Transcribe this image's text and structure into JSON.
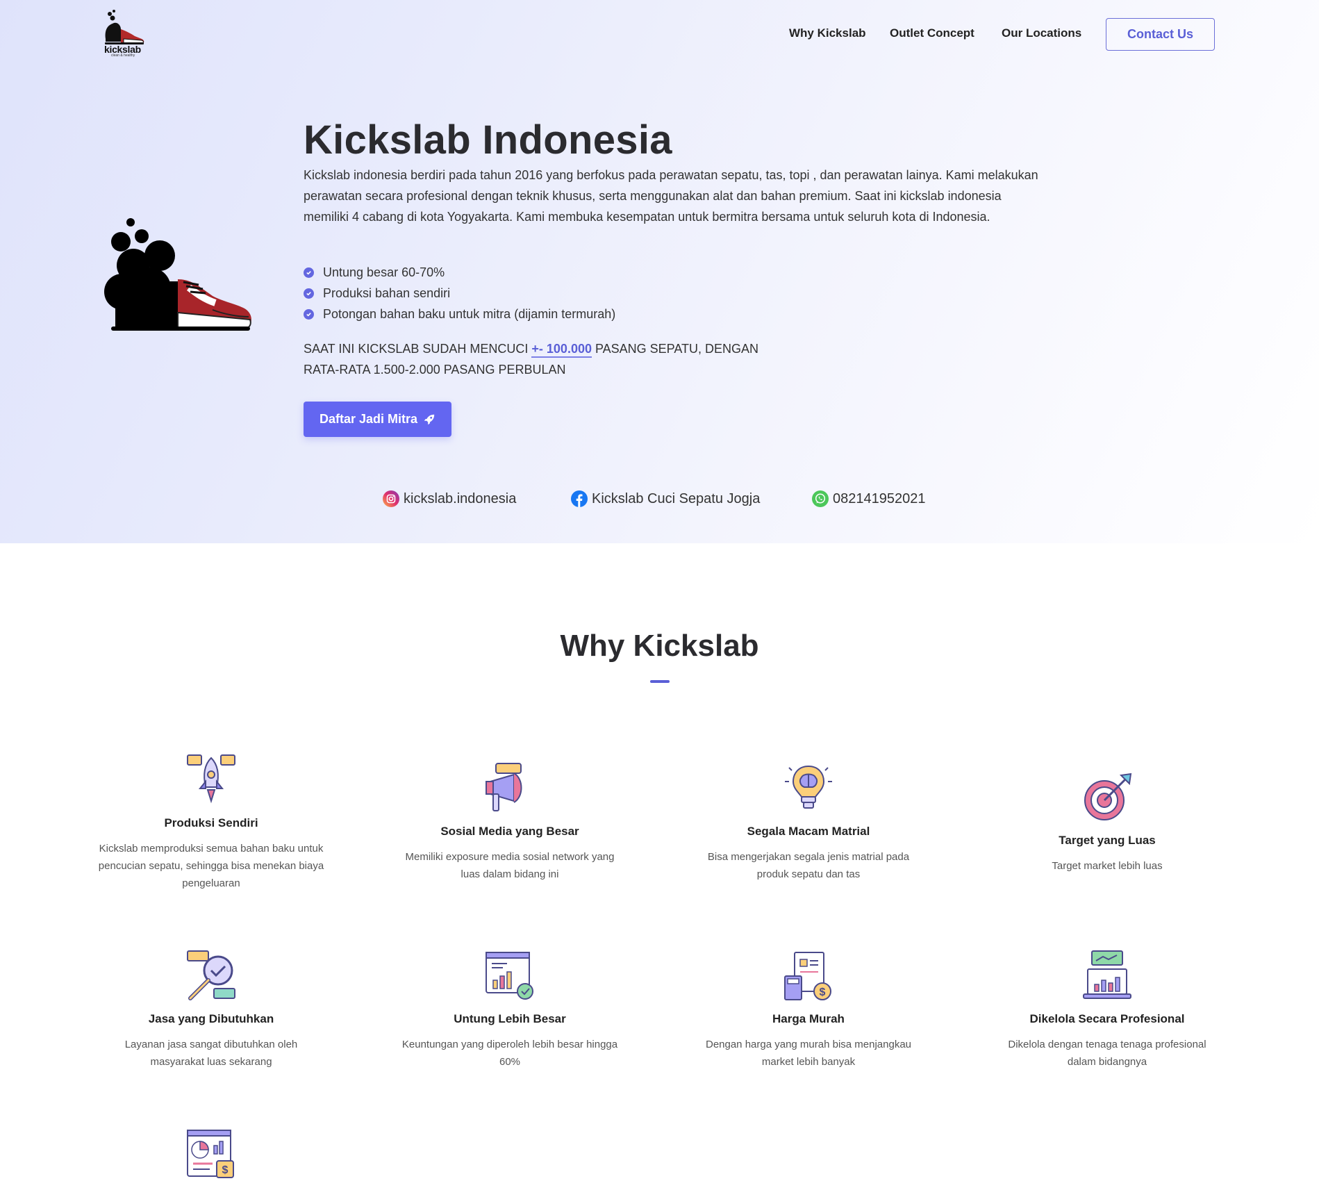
{
  "nav": {
    "logo_text": "kickslab",
    "logo_tagline": "clean & healthy",
    "links": [
      "Why Kickslab",
      "Outlet Concept",
      "Our Locations"
    ],
    "contact_label": "Contact Us"
  },
  "hero": {
    "title": "Kickslab Indonesia",
    "description": "Kickslab indonesia berdiri pada tahun 2016 yang berfokus pada perawatan sepatu, tas, topi , dan perawatan lainya. Kami melakukan perawatan secara profesional dengan teknik khusus, serta menggunakan alat dan bahan premium. Saat ini kickslab indonesia memiliki 4 cabang di kota Yogyakarta. Kami membuka kesempatan untuk bermitra bersama untuk seluruh kota di Indonesia.",
    "features": [
      "Untung besar 60-70%",
      "Produksi bahan sendiri",
      "Potongan bahan baku untuk mitra (dijamin termurah)"
    ],
    "stats_before": "SAAT INI KICKSLAB SUDAH MENCUCI ",
    "stats_highlight": "+- 100.000",
    "stats_after": " PASANG SEPATU, DENGAN RATA-RATA 1.500-2.000 PASANG PERBULAN",
    "cta_label": "Daftar Jadi Mitra",
    "social": {
      "instagram": "kickslab.indonesia",
      "facebook": "Kickslab Cuci Sepatu Jogja",
      "whatsapp": "082141952021"
    }
  },
  "why": {
    "title": "Why Kickslab",
    "cards": [
      {
        "title": "Produksi Sendiri",
        "desc": "Kickslab memproduksi semua bahan baku untuk pencucian sepatu, sehingga bisa menekan biaya pengeluaran",
        "icon": "rocket-icon"
      },
      {
        "title": "Sosial Media yang Besar",
        "desc": "Memiliki exposure media sosial network yang luas dalam bidang ini",
        "icon": "megaphone-icon"
      },
      {
        "title": "Segala Macam Matrial",
        "desc": "Bisa mengerjakan segala jenis matrial pada produk sepatu dan tas",
        "icon": "lightbulb-brain-icon"
      },
      {
        "title": "Target yang Luas",
        "desc": "Target market lebih luas",
        "icon": "target-icon"
      },
      {
        "title": "Jasa yang Dibutuhkan",
        "desc": "Layanan jasa sangat dibutuhkan oleh masyarakat luas sekarang",
        "icon": "magnifier-check-icon"
      },
      {
        "title": "Untung Lebih Besar",
        "desc": "Keuntungan yang diperoleh lebih besar hingga 60%",
        "icon": "chart-window-icon"
      },
      {
        "title": "Harga Murah",
        "desc": "Dengan harga yang murah bisa menjangkau market lebih banyak",
        "icon": "invoice-calculator-icon"
      },
      {
        "title": "Dikelola Secara Profesional",
        "desc": "Dikelola dengan tenaga tenaga profesional dalam bidangnya",
        "icon": "laptop-chart-icon"
      },
      {
        "title": "",
        "desc": "",
        "icon": "report-dollar-icon"
      }
    ]
  },
  "colors": {
    "accent": "#6366f1",
    "text": "#2b2b2f",
    "hero_bg": "#e4e7fc"
  }
}
